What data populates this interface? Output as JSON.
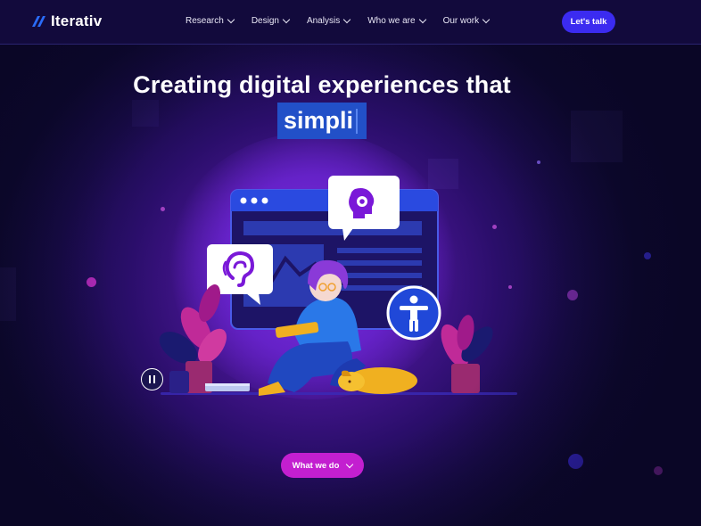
{
  "header": {
    "brand": "Iterativ",
    "nav": [
      {
        "label": "Research"
      },
      {
        "label": "Design"
      },
      {
        "label": "Analysis"
      },
      {
        "label": "Who we are"
      },
      {
        "label": "Our work"
      }
    ],
    "cta_label": "Let's talk"
  },
  "hero": {
    "headline": "Creating digital experiences that",
    "typed_word": "simpli",
    "scroll_button_label": "What we do"
  },
  "icons": [
    "logo-icon",
    "chevron-down-icon",
    "pause-icon",
    "ear-icon",
    "head-gear-icon",
    "accessibility-icon",
    "browser-window-icon",
    "plant-icon",
    "dog-icon",
    "book-icon"
  ],
  "colors": {
    "header_bg": "#120a3c",
    "cta": "#3b2bf0",
    "highlight": "#2250c8",
    "scroll_button": "#c31fd0",
    "background": "#0d0830",
    "glow": "#6a22c4"
  }
}
